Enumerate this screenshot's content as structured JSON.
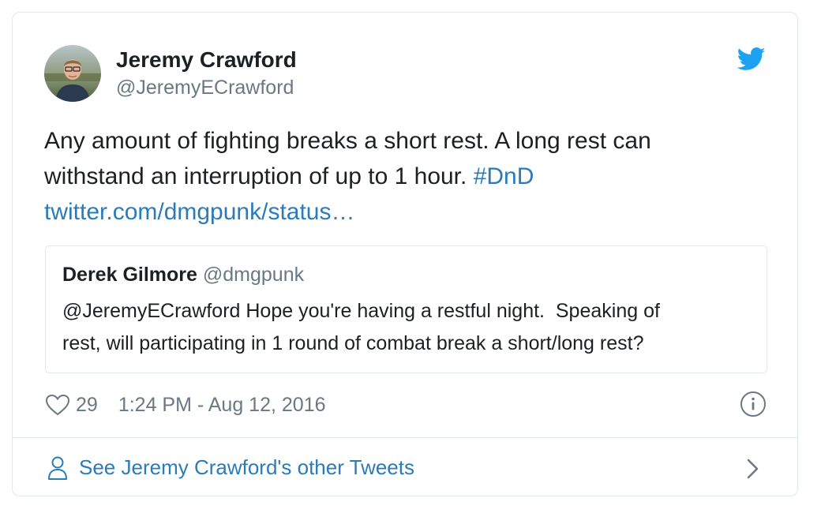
{
  "author": {
    "display_name": "Jeremy Crawford",
    "handle": "@JeremyECrawford"
  },
  "tweet": {
    "text_line1": "Any amount of fighting breaks a short rest. A long rest can",
    "text_line2_plain": "withstand an interruption of up to 1 hour. ",
    "hashtag": "#DnD",
    "link_text": "twitter.com/dmgpunk/status…"
  },
  "quoted_tweet": {
    "display_name": "Derek Gilmore",
    "handle": "@dmgpunk",
    "text_line1": "@JeremyECrawford Hope you're having a restful night.  Speaking of",
    "text_line2": "rest, will participating in 1 round of combat break a short/long rest?"
  },
  "meta": {
    "like_count": "29",
    "timestamp": "1:24 PM - Aug 12, 2016"
  },
  "footer": {
    "label": "See Jeremy Crawford's other Tweets"
  },
  "icons": {
    "brand": "twitter-bird-icon",
    "like": "heart-icon",
    "info": "info-icon",
    "profile": "person-icon",
    "more": "chevron-right-icon"
  },
  "colors": {
    "link": "#2b7bb9",
    "twitter_blue": "#1da1f2",
    "secondary_text": "#697882",
    "primary_text": "#1c2022",
    "border": "#e1e8ed"
  }
}
